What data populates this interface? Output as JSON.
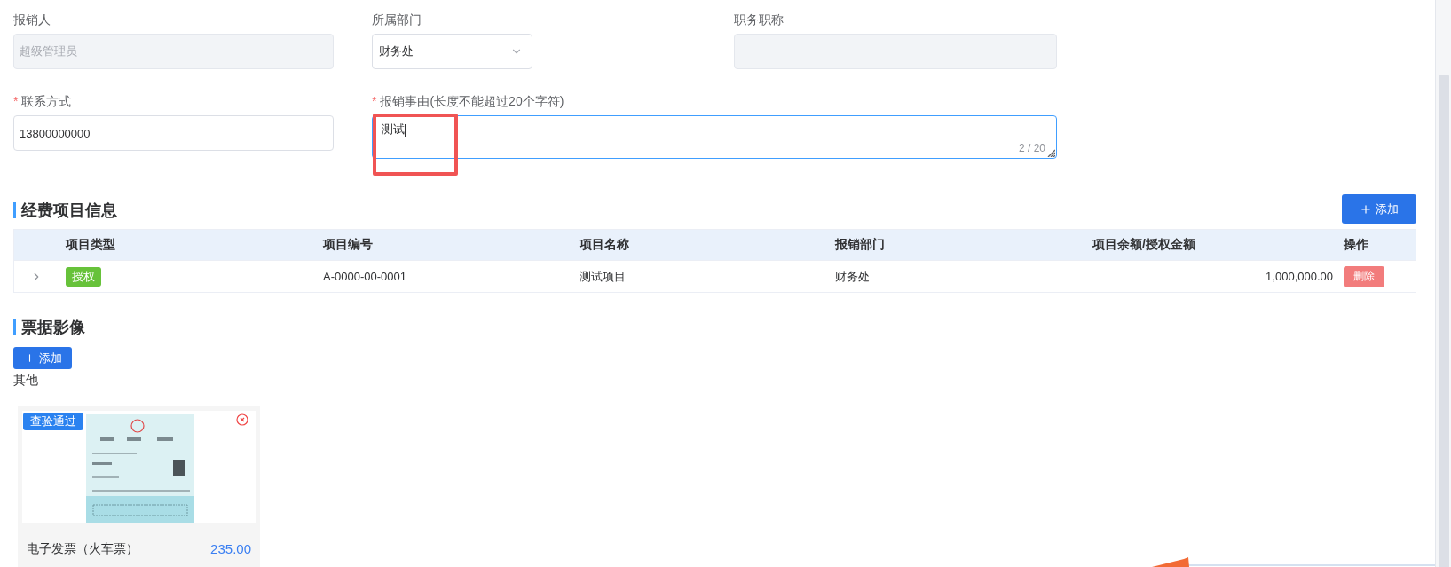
{
  "form": {
    "fields": [
      {
        "label": "报销人",
        "kind": "input",
        "value": "超级管理员",
        "disabled": true
      },
      {
        "label": "所属部门",
        "kind": "select",
        "value": "财务处",
        "disabled": false
      },
      {
        "label": "职务职称",
        "kind": "input",
        "disabled": true
      },
      {
        "label": "联系方式",
        "required_mark": "*",
        "kind": "input",
        "value": "13800000000",
        "disabled": false
      },
      {
        "label": "报销事由(长度不能超过20个字符)",
        "required_mark": "*",
        "kind": "textarea",
        "value": "测试",
        "counter": "2 / 20",
        "focused": true,
        "highlighted": true
      }
    ]
  },
  "funding": {
    "title": "经费项目信息",
    "add_button": "添加",
    "columns": [
      "项目类型",
      "项目编号",
      "项目名称",
      "报销部门",
      "项目余额/授权金额",
      "操作"
    ],
    "rows": [
      {
        "expanded": false,
        "type_tag": "授权",
        "color": "#67c23a",
        "number": "A-0000-00-0001",
        "name": "测试项目",
        "dept": "财务处",
        "amount": "1,000,000.00",
        "action": "删除"
      }
    ]
  },
  "receipts": {
    "title": "票据影像",
    "add_button": "添加",
    "group": "其他",
    "cards": [
      {
        "badge": "查验通过",
        "kind": "picture",
        "title": "电子发票（火车票）",
        "amount": "235.00"
      }
    ]
  }
}
